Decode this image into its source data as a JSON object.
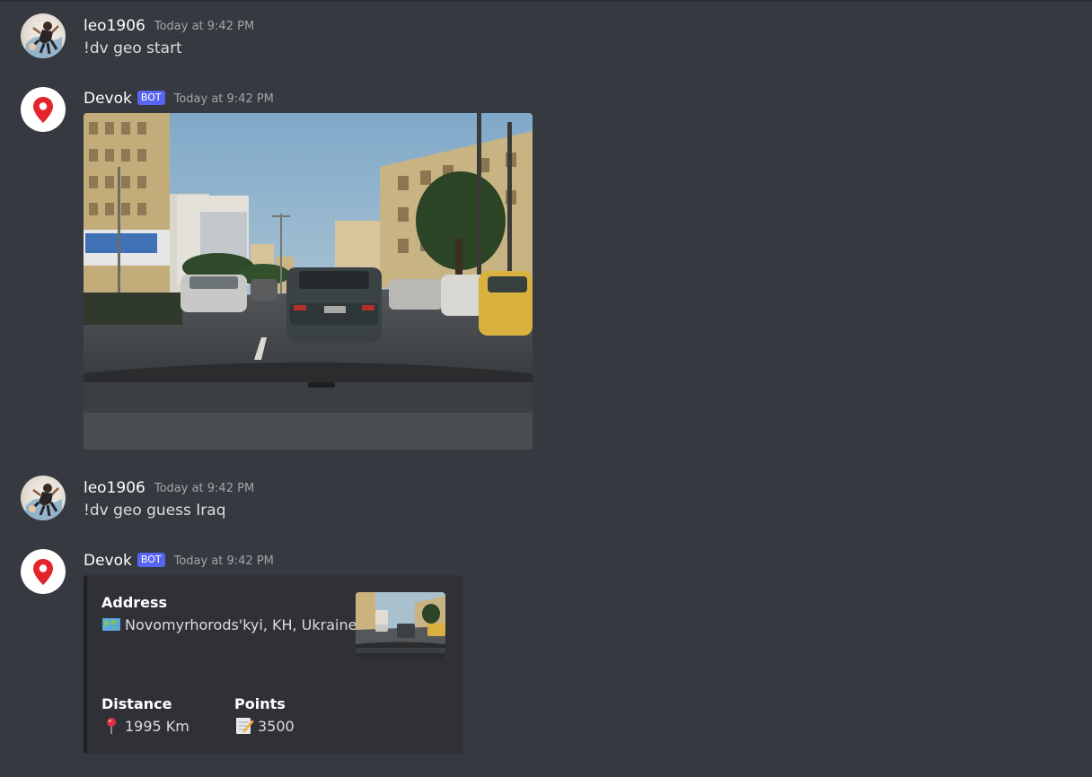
{
  "messages": [
    {
      "author": "leo1906",
      "timestamp": "Today at 9:42 PM",
      "text": "!dv geo start",
      "avatar_icon": "user-avatar-icon"
    },
    {
      "author": "Devok",
      "bot_tag": "BOT",
      "timestamp": "Today at 9:42 PM",
      "avatar_icon": "map-pin-icon",
      "attachment": "street-view-photo"
    },
    {
      "author": "leo1906",
      "timestamp": "Today at 9:42 PM",
      "text": "!dv geo guess Iraq",
      "avatar_icon": "user-avatar-icon"
    },
    {
      "author": "Devok",
      "bot_tag": "BOT",
      "timestamp": "Today at 9:42 PM",
      "avatar_icon": "map-pin-icon",
      "embed": {
        "address_label": "Address",
        "address_value": "Novomyrhorods'kyi, KH, Ukraine",
        "address_icon": "world-map-icon",
        "distance_label": "Distance",
        "distance_value": "1995 Km",
        "distance_icon": "round-pushpin-icon",
        "points_label": "Points",
        "points_value": "3500",
        "points_icon": "memo-icon",
        "thumbnail": "street-view-thumbnail"
      }
    }
  ],
  "colors": {
    "background": "#36393f",
    "embed_background": "#2f3136",
    "embed_border": "#202225",
    "bot_tag": "#5865f2",
    "pin_red": "#e3242b",
    "username": "#ffffff",
    "timestamp": "#a3a6aa",
    "message_text": "#dcddde"
  }
}
